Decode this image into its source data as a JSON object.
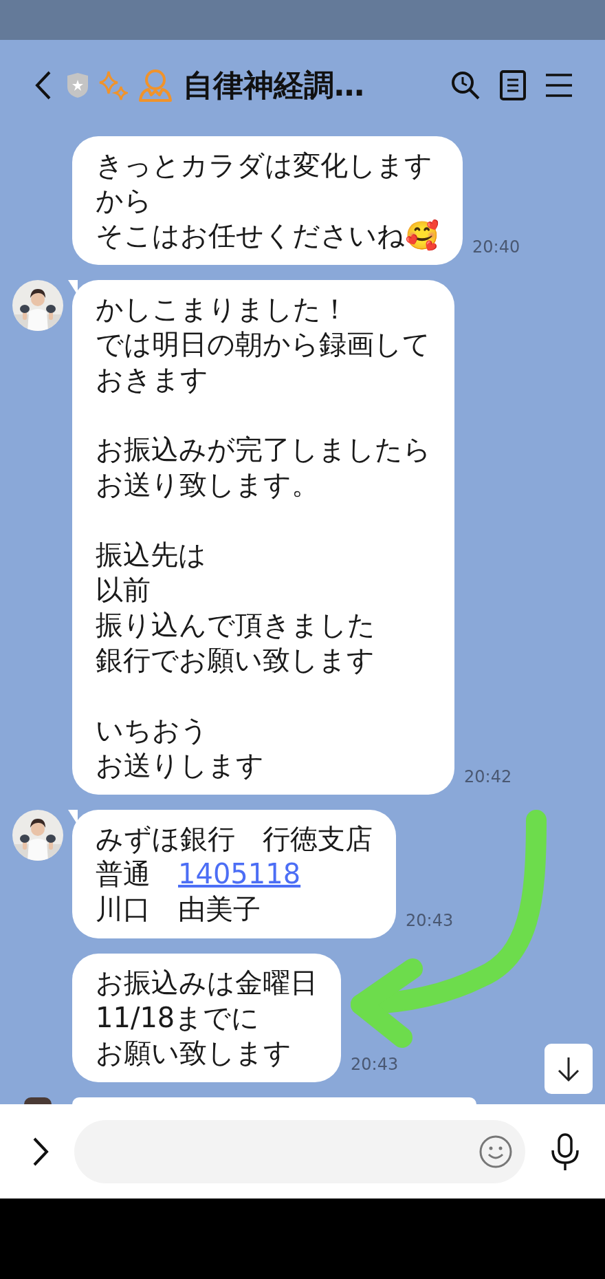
{
  "header": {
    "title": "自律神経調…"
  },
  "messages": [
    {
      "show_avatar": false,
      "lines": [
        {
          "kind": "text",
          "text": "きっとカラダは変化します"
        },
        {
          "kind": "text",
          "text": "から"
        },
        {
          "kind": "text",
          "text": "そこはお任せくださいね🥰"
        }
      ],
      "time": "20:40"
    },
    {
      "show_avatar": true,
      "lines": [
        {
          "kind": "text",
          "text": "かしこまりました！"
        },
        {
          "kind": "text",
          "text": "では明日の朝から録画して"
        },
        {
          "kind": "text",
          "text": "おきます"
        },
        {
          "kind": "blank"
        },
        {
          "kind": "text",
          "text": "お振込みが完了しましたら"
        },
        {
          "kind": "text",
          "text": "お送り致します。"
        },
        {
          "kind": "blank"
        },
        {
          "kind": "text",
          "text": "振込先は"
        },
        {
          "kind": "text",
          "text": "以前"
        },
        {
          "kind": "text",
          "text": "振り込んで頂きました"
        },
        {
          "kind": "text",
          "text": "銀行でお願い致します"
        },
        {
          "kind": "blank"
        },
        {
          "kind": "text",
          "text": "いちおう"
        },
        {
          "kind": "text",
          "text": "お送りします"
        }
      ],
      "time": "20:42"
    },
    {
      "show_avatar": true,
      "lines": [
        {
          "kind": "text",
          "text": "みずほ銀行　行徳支店"
        },
        {
          "kind": "text",
          "text": "普通　",
          "link": "1405118"
        },
        {
          "kind": "text",
          "text": "川口　由美子"
        }
      ],
      "time": "20:43"
    },
    {
      "show_avatar": false,
      "lines": [
        {
          "kind": "text",
          "text": "お振込みは金曜日"
        },
        {
          "kind": "text",
          "text": "11/18までに"
        },
        {
          "kind": "text",
          "text": "お願い致します"
        }
      ],
      "time": "20:43"
    }
  ]
}
